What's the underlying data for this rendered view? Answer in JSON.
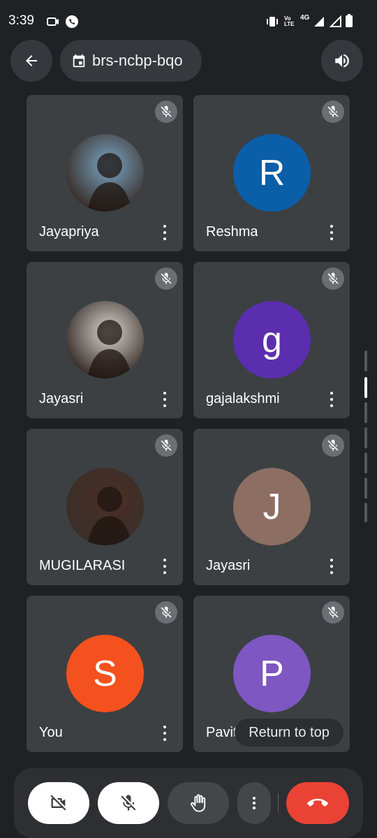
{
  "status_bar": {
    "time": "3:39",
    "network_label": "4G",
    "volte_label": "Vo LTE"
  },
  "header": {
    "meeting_code": "brs-ncbp-bqo",
    "back_icon": "arrow-left-icon",
    "speaker_icon": "speaker-icon"
  },
  "participants": [
    {
      "name": "Jayapriya",
      "avatar_type": "photo",
      "initial": "",
      "color": "#7aa7c7"
    },
    {
      "name": "Reshma",
      "avatar_type": "letter",
      "initial": "R",
      "color": "#0b5ea8"
    },
    {
      "name": "Jayasri",
      "avatar_type": "photo",
      "initial": "",
      "color": "#d9d6d2"
    },
    {
      "name": "gajalakshmi",
      "avatar_type": "letter",
      "initial": "g",
      "color": "#5a2eae"
    },
    {
      "name": "MUGILARASI",
      "avatar_type": "photo",
      "initial": "",
      "color": "#4a2e24"
    },
    {
      "name": "Jayasri",
      "avatar_type": "letter",
      "initial": "J",
      "color": "#8d6e63"
    },
    {
      "name": "You",
      "avatar_type": "letter",
      "initial": "S",
      "color": "#f4511e"
    },
    {
      "name": "Pavith",
      "avatar_type": "letter",
      "initial": "P",
      "color": "#7e57c2"
    }
  ],
  "return_to_top": "Return to top",
  "controls": {
    "camera_off_icon": "camera-off-icon",
    "mic_off_icon": "mic-off-icon",
    "raise_hand_icon": "hand-icon",
    "more_icon": "more-vert-icon",
    "end_call_icon": "end-call-icon",
    "end_call_color": "#ea4335"
  }
}
